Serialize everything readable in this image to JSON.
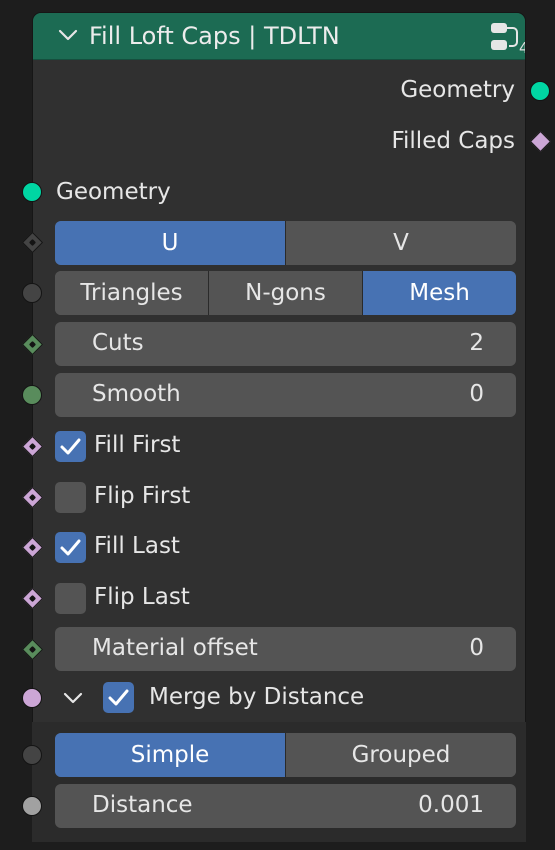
{
  "header": {
    "title": "Fill Loft Caps | TDLTN",
    "group_count": "4",
    "color": "#1c6b53"
  },
  "outputs": [
    {
      "label": "Geometry",
      "socket": "circle",
      "color": "#00d6a3"
    },
    {
      "label": "Filled Caps",
      "socket": "diamond",
      "color": "#cca6d6"
    }
  ],
  "inputs": {
    "geometry": {
      "label": "Geometry",
      "color": "#00d6a3"
    },
    "direction": {
      "options": [
        "U",
        "V"
      ],
      "selected": "U"
    },
    "mode": {
      "options": [
        "Triangles",
        "N-gons",
        "Mesh"
      ],
      "selected": "Mesh"
    },
    "cuts": {
      "label": "Cuts",
      "value": "2"
    },
    "smooth": {
      "label": "Smooth",
      "value": "0"
    },
    "fill_first": {
      "label": "Fill First",
      "checked": true
    },
    "flip_first": {
      "label": "Flip First",
      "checked": false
    },
    "fill_last": {
      "label": "Fill Last",
      "checked": true
    },
    "flip_last": {
      "label": "Flip Last",
      "checked": false
    },
    "material_offset": {
      "label": "Material offset",
      "value": "0"
    }
  },
  "merge_panel": {
    "label": "Merge by Distance",
    "checked": true,
    "expanded": true,
    "mode": {
      "options": [
        "Simple",
        "Grouped"
      ],
      "selected": "Simple"
    },
    "distance": {
      "label": "Distance",
      "value": "0.001"
    }
  },
  "colors": {
    "accent": "#4772b3",
    "geometry_socket": "#00d6a3",
    "boolean_socket": "#cca6d6",
    "int_socket": "#598c5c",
    "float_socket": "#a1a1a1",
    "menu_socket": "#444444"
  }
}
